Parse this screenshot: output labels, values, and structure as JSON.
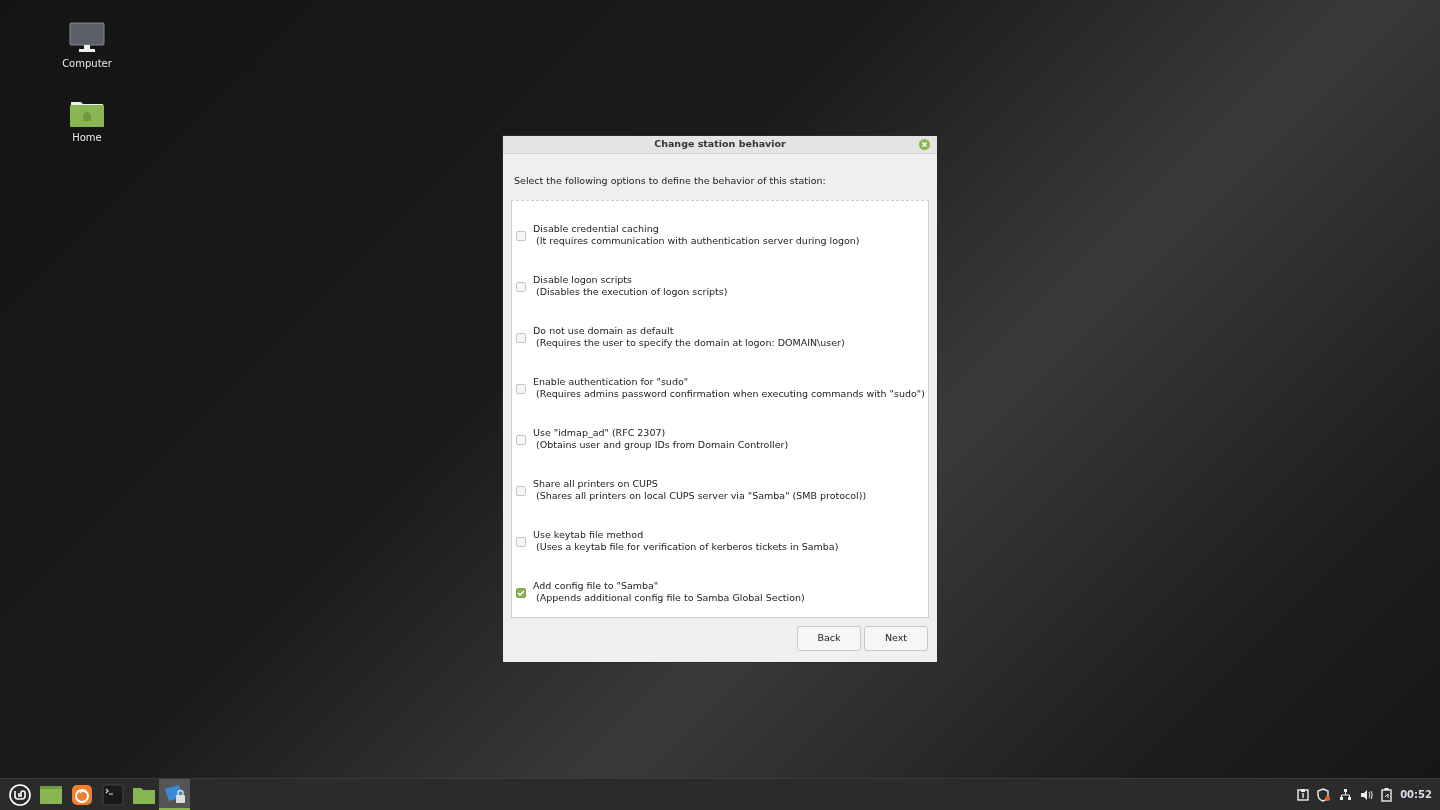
{
  "desktop_icons": [
    {
      "kind": "computer",
      "label": "Computer"
    },
    {
      "kind": "home",
      "label": "Home"
    }
  ],
  "dialog": {
    "title": "Change station behavior",
    "intro": "Select the following options to define the behavior of this station:",
    "options": [
      {
        "title": "Disable credential caching",
        "description": "(It requires communication with authentication server during logon)",
        "checked": false
      },
      {
        "title": "Disable logon scripts",
        "description": "(Disables the execution of logon scripts)",
        "checked": false
      },
      {
        "title": "Do not use domain as default",
        "description": "(Requires the user to specify the domain at logon: DOMAIN\\user)",
        "checked": false
      },
      {
        "title": "Enable authentication for \"sudo\"",
        "description": "(Requires admins password confirmation when executing commands with \"sudo\")",
        "checked": false
      },
      {
        "title": "Use \"idmap_ad\" (RFC 2307)",
        "description": "(Obtains user and group IDs from Domain Controller)",
        "checked": false
      },
      {
        "title": "Share all printers on CUPS",
        "description": "(Shares all printers on local CUPS server via \"Samba\" (SMB protocol))",
        "checked": false
      },
      {
        "title": "Use keytab file method",
        "description": "(Uses a keytab file for verification of kerberos tickets in Samba)",
        "checked": false
      },
      {
        "title": "Add config file to \"Samba\"",
        "description": "(Appends additional config file to Samba Global Section)",
        "checked": true
      }
    ],
    "buttons": [
      "Back",
      "Next"
    ]
  },
  "taskbar": {
    "launchers": [
      {
        "kind": "menu",
        "active": false
      },
      {
        "kind": "window",
        "active": false
      },
      {
        "kind": "browser",
        "active": false
      },
      {
        "kind": "terminal",
        "active": false
      },
      {
        "kind": "folder",
        "active": false
      },
      {
        "kind": "lock-app",
        "active": true
      }
    ],
    "tray": [
      {
        "kind": "clipboard"
      },
      {
        "kind": "shield"
      },
      {
        "kind": "network"
      },
      {
        "kind": "volume"
      },
      {
        "kind": "battery"
      }
    ],
    "clock": "00:52"
  }
}
